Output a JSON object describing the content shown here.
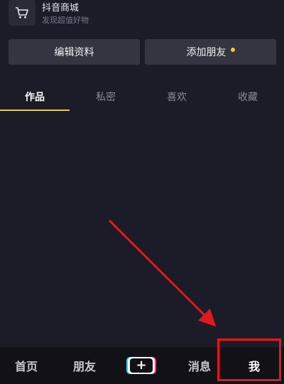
{
  "shop": {
    "title": "抖音商城",
    "subtitle": "发现超值好物",
    "icon": "cart-icon"
  },
  "actions": {
    "edit_label": "编辑资料",
    "add_friend_label": "添加朋友",
    "add_friend_dot_color": "#f3c836"
  },
  "tabs": [
    {
      "label": "作品",
      "active": true
    },
    {
      "label": "私密",
      "active": false
    },
    {
      "label": "喜欢",
      "active": false
    },
    {
      "label": "收藏",
      "active": false
    }
  ],
  "nav": {
    "home": "首页",
    "friends": "朋友",
    "create": "+",
    "messages": "消息",
    "me": "我"
  },
  "annotation": {
    "color": "#e0191b",
    "target": "nav-me"
  },
  "colors": {
    "background": "#1c1c28",
    "accent": "#f3c836",
    "nav_background": "#111117"
  }
}
